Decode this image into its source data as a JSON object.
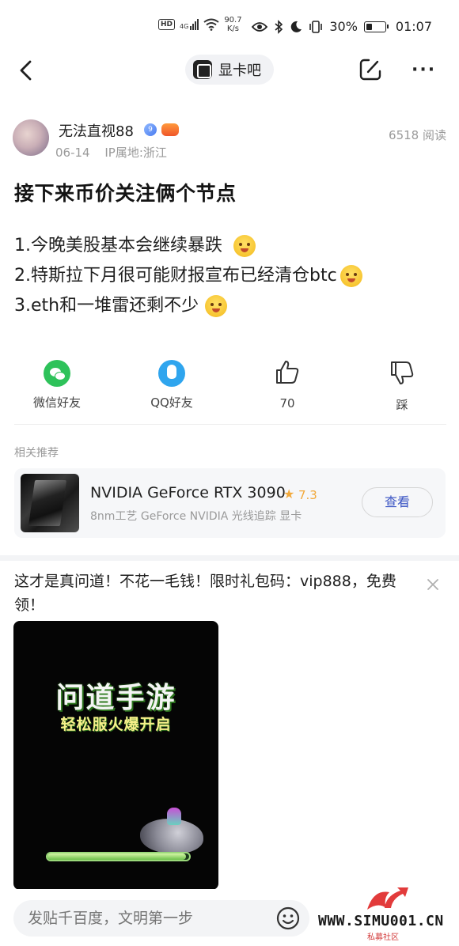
{
  "status_bar": {
    "hd": "HD",
    "signal_label": "4G",
    "net_speed_value": "90.7",
    "net_speed_unit": "K/s",
    "battery": "30%",
    "battery_level": 0.3,
    "time": "01:07"
  },
  "nav": {
    "forum_name": "显卡吧"
  },
  "author": {
    "name": "无法直视88",
    "level": "9",
    "date": "06-14",
    "ip_location": "IP属地:浙江",
    "views": "6518 阅读"
  },
  "post": {
    "title": "接下来币价关注俩个节点",
    "lines": [
      "1.今晚美股基本会继续暴跌",
      "2.特斯拉下月很可能财报宣布已经清仓btc",
      "3.eth和一堆雷还剩不少"
    ]
  },
  "actions": {
    "wechat": "微信好友",
    "qq": "QQ好友",
    "like_count": "70",
    "dislike": "踩"
  },
  "related": {
    "heading": "相关推荐",
    "product_name": "NVIDIA GeForce RTX 3090",
    "rating": "7.3",
    "description": "8nm工艺 GeForce NVIDIA 光线追踪 显卡",
    "view_button": "查看"
  },
  "ad": {
    "text": "这才是真问道！不花一毛钱！限时礼包码：vip888，免费领！",
    "game_title": "问道手游",
    "game_subtitle": "轻松服火爆开启",
    "progress": 0.98
  },
  "bottom": {
    "reply_placeholder": "发贴千百度，文明第一步"
  },
  "watermark": {
    "text": "WWW.SIMU001.CN",
    "sub": "私募社区"
  },
  "colors": {
    "accent_blue": "#3b55c4",
    "rating_orange": "#f2a93b",
    "wechat_green": "#2ec25a",
    "qq_blue": "#2fa5ee"
  }
}
